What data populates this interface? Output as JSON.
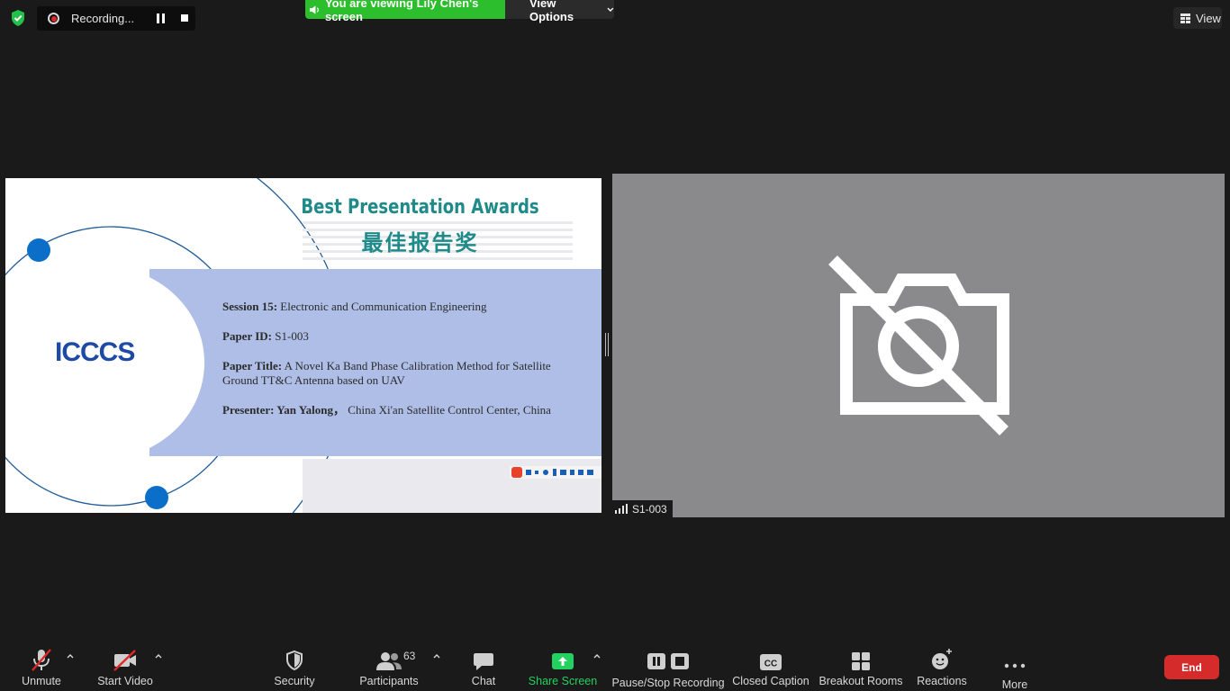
{
  "top_bar": {
    "recording_label": "Recording...",
    "viewing_banner": "You are viewing Lily Chen's screen",
    "view_options_label": "View Options",
    "view_label": "View"
  },
  "shared_slide": {
    "award_title_en": "Best Presentation Awards",
    "award_title_cn": "最佳报告奖",
    "logo_text": "ICCCS",
    "session_label": "Session 15:",
    "session_value": "Electronic and Communication Engineering",
    "paper_id_label": "Paper ID:",
    "paper_id_value": "S1-003",
    "paper_title_label": "Paper Title:",
    "paper_title_value_line1": "A Novel Ka Band Phase Calibration Method for Satellite",
    "paper_title_value_line2": "Ground TT&C Antenna based on UAV",
    "presenter_label": "Presenter: Yan Yalong",
    "presenter_value": "China Xi'an Satellite Control Center, China"
  },
  "participant_tile": {
    "name": "S1-003"
  },
  "toolbar": {
    "unmute": "Unmute",
    "start_video": "Start Video",
    "security": "Security",
    "participants": "Participants",
    "participants_count": "63",
    "chat": "Chat",
    "share_screen": "Share Screen",
    "pause_stop_recording": "Pause/Stop Recording",
    "closed_caption": "Closed Caption",
    "breakout_rooms": "Breakout Rooms",
    "reactions": "Reactions",
    "more": "More",
    "end": "End"
  },
  "colors": {
    "background": "#1a1a1a",
    "banner_green": "#2dbe2d",
    "share_green": "#23d160",
    "end_red": "#d62b2b",
    "tile_gray": "#8a898b",
    "slide_band": "#aebee6",
    "award_teal": "#1f8a8a"
  }
}
